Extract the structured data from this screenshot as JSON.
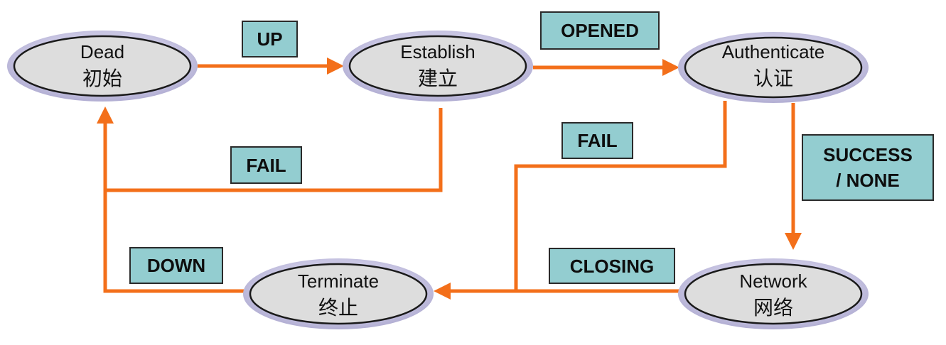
{
  "diagram": {
    "states": {
      "dead": {
        "en": "Dead",
        "cn": "初始"
      },
      "establish": {
        "en": "Establish",
        "cn": "建立"
      },
      "authenticate": {
        "en": "Authenticate",
        "cn": "认证"
      },
      "network": {
        "en": "Network",
        "cn": "网络"
      },
      "terminate": {
        "en": "Terminate",
        "cn": "终止"
      }
    },
    "transitions": {
      "up": "UP",
      "opened": "OPENED",
      "fail_establish": "FAIL",
      "fail_authenticate": "FAIL",
      "success_none": "SUCCESS\n/ NONE",
      "closing": "CLOSING",
      "down": "DOWN"
    },
    "colors": {
      "arrow": "#F36F1A",
      "label_bg": "#93CDD0",
      "node_fill": "#DDDDDD",
      "node_rim": "#BFBBD9"
    }
  }
}
